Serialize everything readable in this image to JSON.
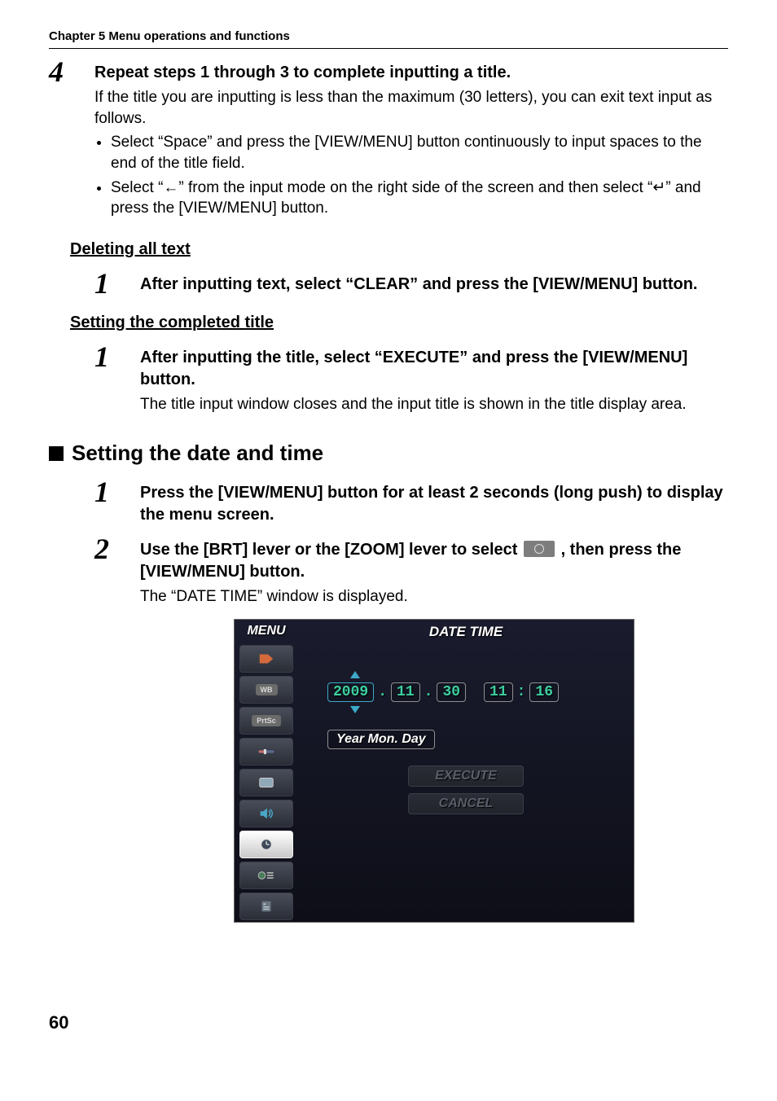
{
  "chapter_header": "Chapter 5 Menu operations and functions",
  "step4": {
    "num": "4",
    "title": "Repeat steps 1 through 3 to complete inputting a title.",
    "text": "If the title you are inputting is less than the maximum (30 letters), you can exit text input as follows.",
    "bullet1": "Select “Space” and press the [VIEW/MENU] button continuously to input spaces to the end of the title field.",
    "bullet2": "Select “←” from the input mode on the right side of the screen and then select “↵” and press the [VIEW/MENU] button."
  },
  "deleting": {
    "heading": "Deleting all text",
    "step1_num": "1",
    "step1_title": "After inputting text, select “CLEAR” and press the [VIEW/MENU] button."
  },
  "setting_title": {
    "heading": "Setting the completed title",
    "step1_num": "1",
    "step1_title": "After inputting the title, select “EXECUTE” and press the [VIEW/MENU] button.",
    "step1_text": "The title input window closes and the input title is shown in the title display area."
  },
  "section_heading": "Setting the date and time",
  "dt_step1": {
    "num": "1",
    "title": "Press the [VIEW/MENU] button for at least 2 seconds (long push) to display the menu screen."
  },
  "dt_step2": {
    "num": "2",
    "title_a": "Use the [BRT] lever or the [ZOOM] lever to select ",
    "title_b": ", then press the [VIEW/MENU] button.",
    "text": "The “DATE TIME” window is displayed."
  },
  "menu_screenshot": {
    "menu_label": "MENU",
    "title": "DATE TIME",
    "tabs": {
      "tag": "",
      "wb": "WB",
      "prtsc": "PrtSc",
      "slider": "",
      "screen": "",
      "sound": "",
      "clock": "",
      "system": "",
      "info": ""
    },
    "date": {
      "year": "2009",
      "month": "11",
      "day": "30",
      "hour": "11",
      "minute": "16"
    },
    "format_label": "Year   Mon. Day",
    "execute": "EXECUTE",
    "cancel": "CANCEL"
  },
  "page_number": "60"
}
